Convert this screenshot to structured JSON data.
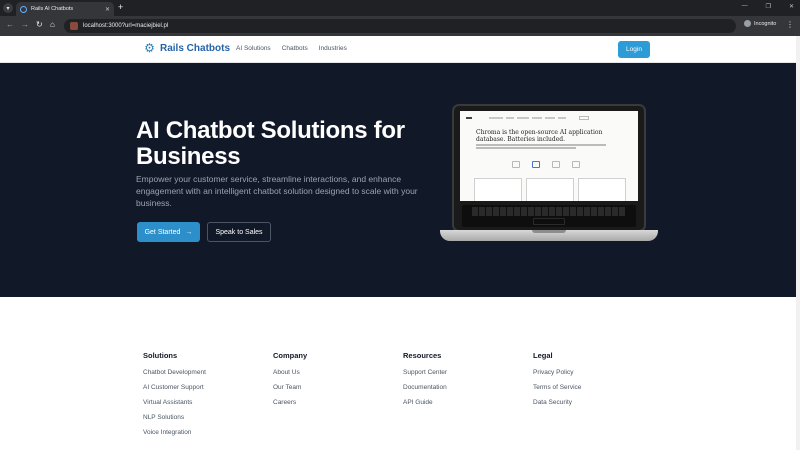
{
  "browser": {
    "tab_title": "Rails AI Chatbots",
    "url": "localhost:3000?url=maciejbiel.pl",
    "incognito_label": "Incognito"
  },
  "header": {
    "brand": "Rails Chatbots",
    "nav": [
      "AI Solutions",
      "Chatbots",
      "Industries"
    ],
    "login_label": "Login"
  },
  "hero": {
    "title": "AI Chatbot Solutions for Business",
    "description": "Empower your customer service, streamline interactions, and enhance engagement with an intelligent chatbot solution designed to scale with your business.",
    "primary_cta": "Get Started",
    "secondary_cta": "Speak to Sales",
    "laptop_screen_headline": "Chroma is the open-source AI application database. Batteries included."
  },
  "footer": {
    "columns": [
      {
        "heading": "Solutions",
        "links": [
          "Chatbot Development",
          "AI Customer Support",
          "Virtual Assistants",
          "NLP Solutions",
          "Voice Integration"
        ]
      },
      {
        "heading": "Company",
        "links": [
          "About Us",
          "Our Team",
          "Careers"
        ]
      },
      {
        "heading": "Resources",
        "links": [
          "Support Center",
          "Documentation",
          "API Guide"
        ]
      },
      {
        "heading": "Legal",
        "links": [
          "Privacy Policy",
          "Terms of Service",
          "Data Security"
        ]
      }
    ]
  },
  "colors": {
    "hero_bg": "#111827",
    "brand": "#2563a8",
    "accent": "#2d8fc9"
  }
}
